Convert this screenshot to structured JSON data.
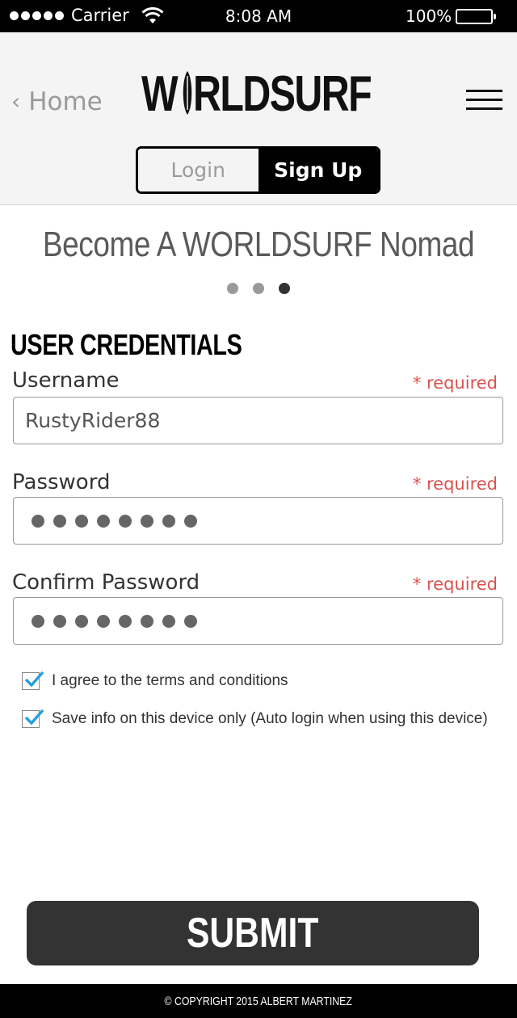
{
  "status_bar": {
    "carrier": "Carrier",
    "time": "8:08 AM",
    "battery_percent": "100%",
    "signal_bars": 5
  },
  "header": {
    "back_label": "Home",
    "logo_first": "W",
    "logo_rest": "RLDSURF",
    "logo_text": "WORLDSURF",
    "menu_icon": "hamburger-menu-icon",
    "tabs": [
      {
        "label": "Login",
        "active": false
      },
      {
        "label": "Sign Up",
        "active": true
      }
    ]
  },
  "main": {
    "headline": "Become A WORLDSURF Nomad",
    "step_indicator": {
      "total": 3,
      "current": 3
    },
    "section_title": "USER CREDENTIALS",
    "fields": [
      {
        "label": "Username",
        "required_text": "* required",
        "value": "RustyRider88"
      },
      {
        "label": "Password",
        "required_text": "* required",
        "value_masked_length": 8
      },
      {
        "label": "Confirm Password",
        "required_text": "* required",
        "value_masked_length": 8
      }
    ],
    "checkboxes": [
      {
        "label": "I agree to the terms and conditions",
        "checked": true
      },
      {
        "label": "Save info on this device only (Auto login when using this device)",
        "checked": true
      }
    ],
    "submit_label": "SUBMIT"
  },
  "footer": {
    "copyright": "© COPYRIGHT 2015 ALBERT MARTINEZ"
  },
  "colors": {
    "header_bg": "#f4f4f4",
    "required": "#d9534f",
    "check_accent": "#2a9fd6",
    "submit_bg": "#333333"
  }
}
